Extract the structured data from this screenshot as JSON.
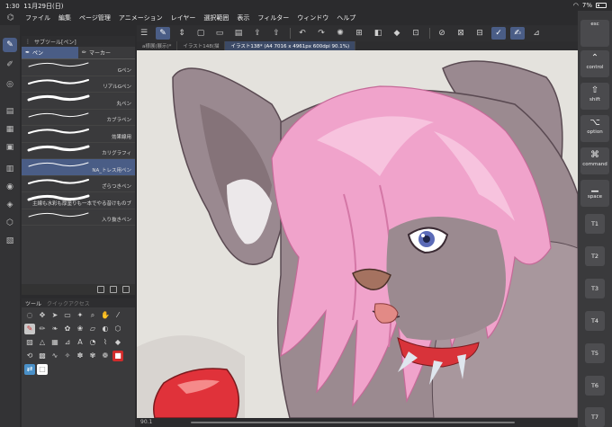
{
  "status": {
    "time": "1:30",
    "date": "11月29日(日)",
    "battery": "7%"
  },
  "menu": [
    "ファイル",
    "編集",
    "ページ管理",
    "アニメーション",
    "レイヤー",
    "選択範囲",
    "表示",
    "フィルター",
    "ウィンドウ",
    "ヘルプ"
  ],
  "subtool": {
    "panel_title": "サブツール[ペン]",
    "tab_pen": "ペン",
    "tab_marker": "マーカー",
    "brushes": [
      {
        "name": "Gペン",
        "active": false
      },
      {
        "name": "リアルGペン",
        "active": false
      },
      {
        "name": "丸ペン",
        "active": false
      },
      {
        "name": "カブラペン",
        "active": false
      },
      {
        "name": "効果線用",
        "active": false
      },
      {
        "name": "カリグラフィ",
        "active": false
      },
      {
        "name": "NA_トレス用ペン",
        "active": true
      },
      {
        "name": "ざらつきペン",
        "active": false
      },
      {
        "name": "主線も水彩も厚塗りも一本でやる昔けものブ",
        "active": false
      },
      {
        "name": "入り抜きペン",
        "active": false
      }
    ]
  },
  "toolpanel": {
    "tab_tool": "ツール",
    "tab_quick": "クイックアクセス"
  },
  "doctabs": [
    {
      "label": "a様展(展示)*",
      "active": false
    },
    {
      "label": "イラスト148(描",
      "active": false
    },
    {
      "label": "イラスト138* (A4 7016 x 4961px 600dpi 90.1%)",
      "active": true
    }
  ],
  "zoom": "90.1",
  "modifiers": [
    {
      "label": "esc",
      "icon": ""
    },
    {
      "label": "control",
      "icon": "⌃"
    },
    {
      "label": "shift",
      "icon": "⇧"
    },
    {
      "label": "option",
      "icon": "⌥"
    },
    {
      "label": "command",
      "icon": "⌘"
    },
    {
      "label": "space",
      "icon": "▁"
    }
  ],
  "tkeys": [
    "T1",
    "T2",
    "T3",
    "T4",
    "T5",
    "T6",
    "T7"
  ],
  "colors": {
    "accent": "#4a5d86",
    "hair": "#f2a7cf",
    "fur": "#9b8a90",
    "collar": "#d8333a"
  }
}
